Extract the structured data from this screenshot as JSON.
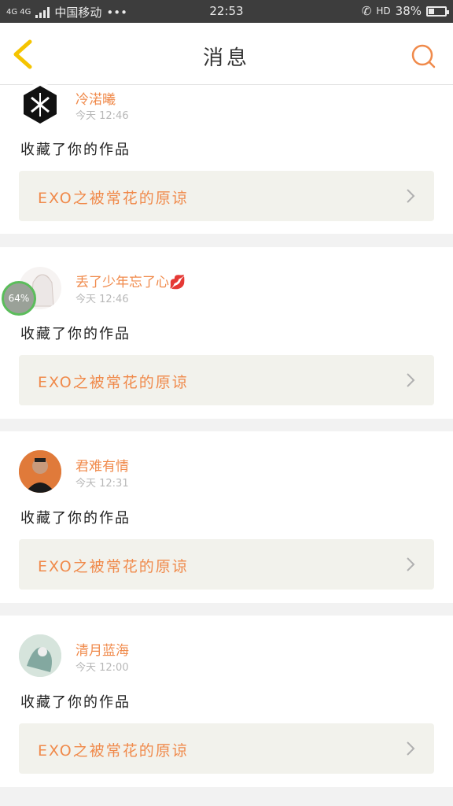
{
  "status_bar": {
    "network": "4G 4G",
    "carrier": "中国移动",
    "dots": "•••",
    "time": "22:53",
    "hd": "HD",
    "battery_pct": "38%",
    "battery_level": 0.38
  },
  "nav": {
    "title": "消息",
    "back_icon": "chevron-left-icon",
    "search_icon": "search-icon"
  },
  "messages": [
    {
      "name": "冷渃曦",
      "time": "今天 12:46",
      "action": "收藏了你的作品",
      "work_title": "EXO之被常花的原谅",
      "avatar": "exo-logo"
    },
    {
      "name": "丢了少年忘了心💋",
      "time": "今天 12:46",
      "action": "收藏了你的作品",
      "work_title": "EXO之被常花的原谅",
      "avatar": "anime-girl"
    },
    {
      "name": "君难有情",
      "time": "今天 12:31",
      "action": "收藏了你的作品",
      "work_title": "EXO之被常花的原谅",
      "avatar": "man-portrait"
    },
    {
      "name": "清月蓝海",
      "time": "今天 12:00",
      "action": "收藏了你的作品",
      "work_title": "EXO之被常花的原谅",
      "avatar": "ink-figure"
    }
  ],
  "floating_badge": {
    "text": "64%"
  },
  "colors": {
    "accent": "#f08a4b",
    "back_icon": "#f5c400",
    "status_bar": "#3d3d3d",
    "work_bg": "#f2f2ec"
  }
}
